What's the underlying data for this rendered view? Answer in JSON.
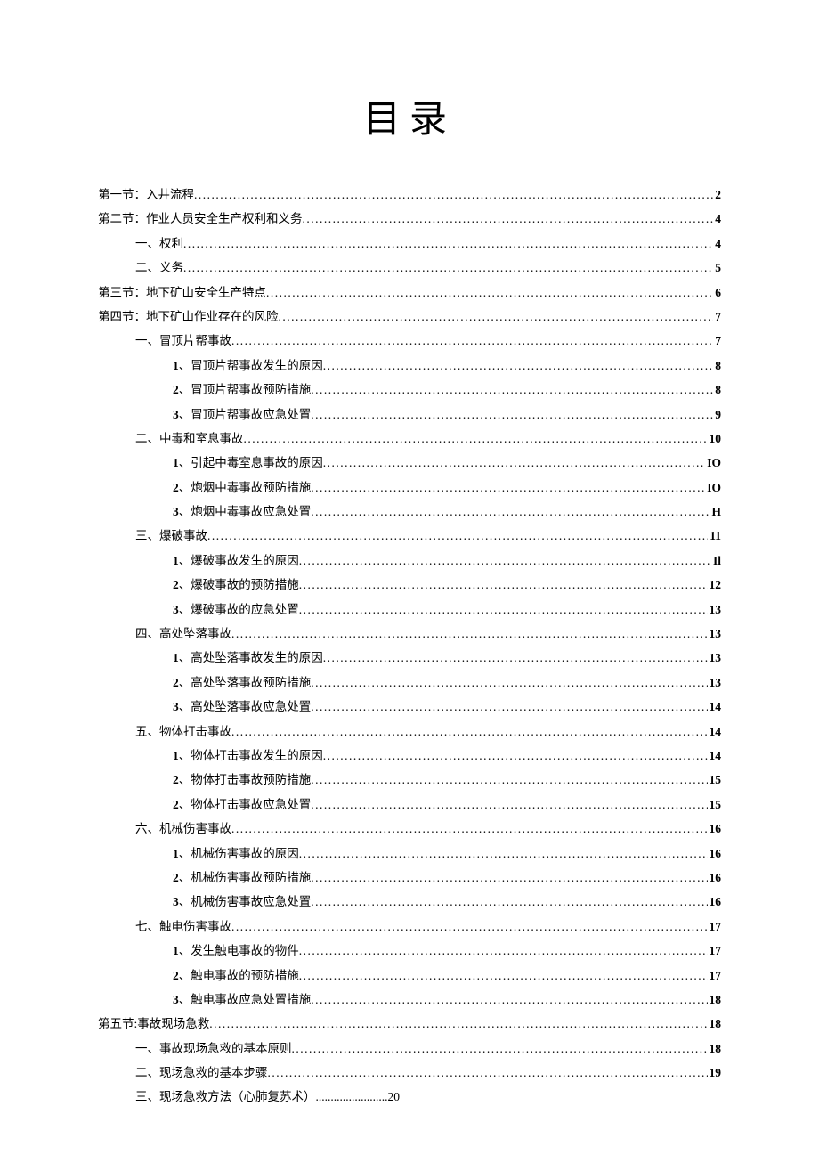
{
  "title": "目录",
  "entries": [
    {
      "indent": 0,
      "label": "第一节：入井流程",
      "page": "2"
    },
    {
      "indent": 0,
      "label": "第二节：作业人员安全生产权利和义务",
      "page": "4"
    },
    {
      "indent": 1,
      "label": "一、权利",
      "page": "4"
    },
    {
      "indent": 1,
      "label": "二、义务",
      "page": "5"
    },
    {
      "indent": 0,
      "label": "第三节：地下矿山安全生产特点",
      "page": "6"
    },
    {
      "indent": 0,
      "label": "第四节：地下矿山作业存在的风险",
      "page": "7"
    },
    {
      "indent": 1,
      "label": "一、冒顶片帮事故",
      "page": "7"
    },
    {
      "indent": 2,
      "num": "1",
      "label": "、冒顶片帮事故发生的原因",
      "page": "8"
    },
    {
      "indent": 2,
      "num": "2",
      "label": "、冒顶片帮事故预防措施",
      "page": "8"
    },
    {
      "indent": 2,
      "num": "3",
      "label": "、冒顶片帮事故应急处置",
      "page": "9"
    },
    {
      "indent": 1,
      "label": "二、中毒和室息事故",
      "page": "10"
    },
    {
      "indent": 2,
      "num": "1",
      "label": "、引起中毒室息事故的原因",
      "page": "IO"
    },
    {
      "indent": 2,
      "num": "2",
      "label": "、炮烟中毒事故预防措施",
      "page": "IO"
    },
    {
      "indent": 2,
      "num": "3",
      "label": "、炮烟中毒事故应急处置",
      "page": "H"
    },
    {
      "indent": 1,
      "label": "三、爆破事故",
      "page": "11"
    },
    {
      "indent": 2,
      "num": "1",
      "label": "、爆破事故发生的原因",
      "page": "Il"
    },
    {
      "indent": 2,
      "num": "2",
      "label": "、爆破事故的预防措施",
      "page": "12"
    },
    {
      "indent": 2,
      "num": "3",
      "label": "、爆破事故的应急处置",
      "page": "13"
    },
    {
      "indent": 1,
      "label": "四、高处坠落事故",
      "page": "13"
    },
    {
      "indent": 2,
      "num": "1",
      "label": "、高处坠落事故发生的原因",
      "page": "13"
    },
    {
      "indent": 2,
      "num": "2",
      "label": "、高处坠落事故预防措施",
      "page": "13"
    },
    {
      "indent": 2,
      "num": "3",
      "label": "、高处坠落事故应急处置",
      "page": "14"
    },
    {
      "indent": 1,
      "label": "五、物体打击事故",
      "page": "14"
    },
    {
      "indent": 2,
      "num": "1",
      "label": "、物体打击事故发生的原因",
      "page": "14"
    },
    {
      "indent": 2,
      "num": "2",
      "label": "、物体打击事故预防措施",
      "page": "15"
    },
    {
      "indent": 2,
      "num": "2",
      "label": "、物体打击事故应急处置",
      "page": "15"
    },
    {
      "indent": 1,
      "label": "六、机械伤害事故",
      "page": "16"
    },
    {
      "indent": 2,
      "num": "1",
      "label": "、机械伤害事故的原因",
      "page": "16"
    },
    {
      "indent": 2,
      "num": "2",
      "label": "、机械伤害事故预防措施",
      "page": "16"
    },
    {
      "indent": 2,
      "num": "3",
      "label": "、机械伤害事故应急处置",
      "page": "16"
    },
    {
      "indent": 1,
      "label": "七、触电伤害事故",
      "page": "17"
    },
    {
      "indent": 2,
      "num": "1",
      "label": "、发生触电事故的物件",
      "page": "17"
    },
    {
      "indent": 2,
      "num": "2",
      "label": "、触电事故的预防措施",
      "page": "17"
    },
    {
      "indent": 2,
      "num": "3",
      "label": "、触电事故应急处置措施",
      "page": "18"
    },
    {
      "indent": 0,
      "label": "第五节:事故现场急救",
      "page": "18"
    },
    {
      "indent": 1,
      "label": "一、事故现场急救的基本原则",
      "page": "18"
    },
    {
      "indent": 1,
      "label": "二、现场急救的基本步骤",
      "page": "19"
    },
    {
      "indent": 1,
      "label": "三、现场急救方法（心肺复苏术）",
      "page": "20",
      "special": true
    }
  ]
}
